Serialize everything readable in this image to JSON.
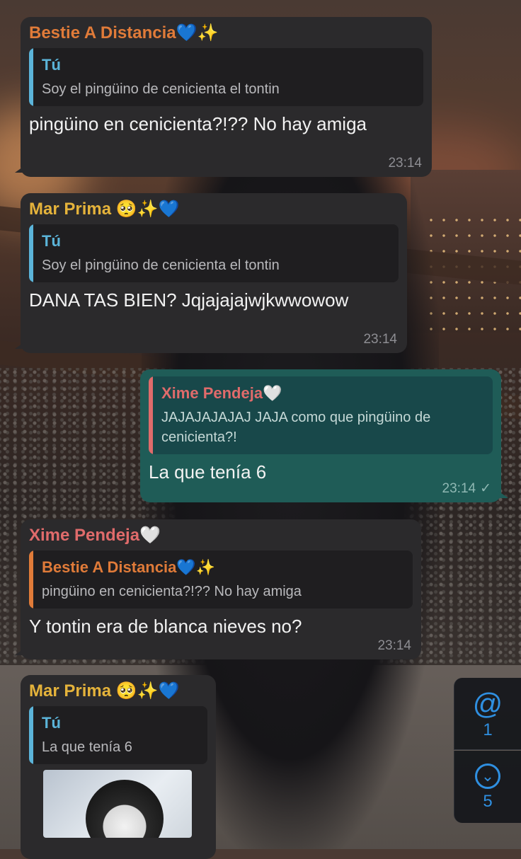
{
  "colors": {
    "incoming_bubble": "#2b2a2c",
    "outgoing_bubble": "#1f5c57",
    "orange_name": "#e07b39",
    "gold_name": "#e5b33b",
    "pink_name": "#e06b6b",
    "blue_name": "#5bb4d9",
    "accent_blue": "#2f8fe0"
  },
  "messages": [
    {
      "sender": "Bestie A Distancia💙✨",
      "quote_name": "Tú",
      "quote_text": "Soy el pingüino de cenicienta el tontin",
      "text": "pingüino en cenicienta?!?? No hay amiga",
      "time": "23:14"
    },
    {
      "sender": "Mar Prima 🥺✨💙",
      "quote_name": "Tú",
      "quote_text": "Soy el pingüino de cenicienta el tontin",
      "text": "DANA TAS BIEN? Jqjajajajwjkwwowow",
      "time": "23:14"
    },
    {
      "sender": "",
      "quote_name": "Xime Pendeja🤍",
      "quote_text": "JAJAJAJAJAJ JAJA como que pingüino de cenicienta?!",
      "text": "La que tenía 6",
      "time": "23:14",
      "status": "✓"
    },
    {
      "sender": "Xime Pendeja🤍",
      "quote_name": "Bestie A Distancia💙✨",
      "quote_text": "pingüino en cenicienta?!?? No hay amiga",
      "text": "Y tontin era de blanca nieves no?",
      "time": "23:14"
    },
    {
      "sender": "Mar Prima 🥺✨💙",
      "quote_name": "Tú",
      "quote_text": "La que tenía 6",
      "text": "",
      "time": ""
    }
  ],
  "mentions": {
    "icon": "@",
    "count": "1"
  },
  "scroll_down": {
    "icon": "chevron-down-icon",
    "glyph": "⌄",
    "count": "5"
  }
}
